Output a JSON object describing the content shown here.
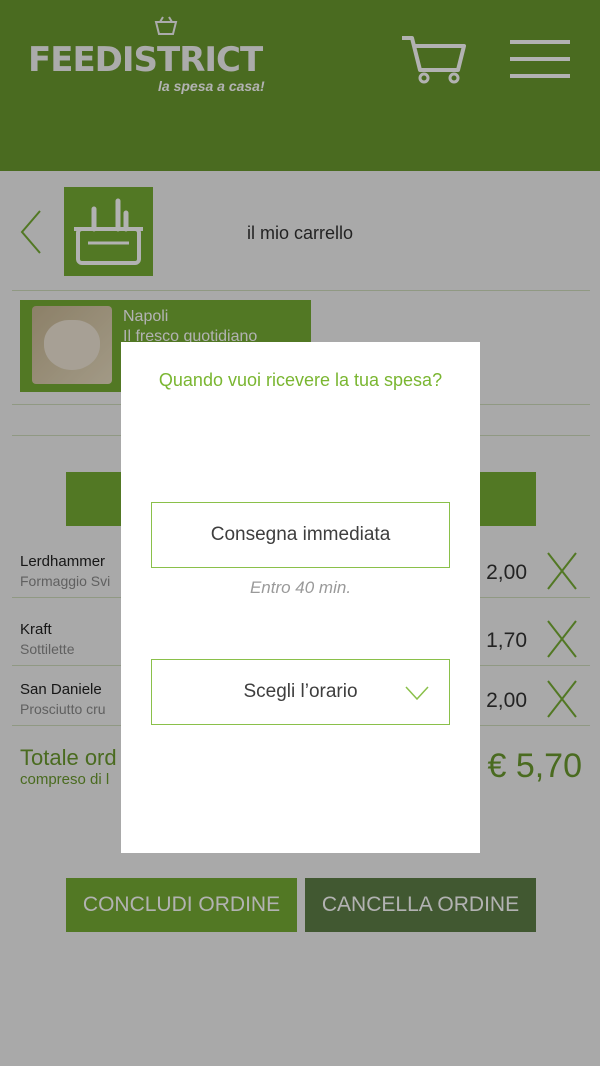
{
  "header": {
    "logo_text": "FEEDISTRICT",
    "tagline": "la spesa a casa!",
    "cart_icon": "cart-icon",
    "menu_icon": "hamburger-menu-icon"
  },
  "cart": {
    "title": "il mio carrello",
    "back_icon": "chevron-left-icon",
    "basket_icon": "basket-icon"
  },
  "store": {
    "city": "Napoli",
    "name": "Il fresco quotidiano"
  },
  "items": [
    {
      "name": "Lerdhammer",
      "desc": "Formaggio Svi",
      "price": "2,00"
    },
    {
      "name": "Kraft",
      "desc": "Sottilette",
      "price": "1,70"
    },
    {
      "name": "San Daniele",
      "desc": "Prosciutto cru",
      "price": "2,00"
    }
  ],
  "total": {
    "label": "Totale ord",
    "sub": "compreso di l",
    "value": "€ 5,70"
  },
  "buttons": {
    "conclude": "CONCLUDI ORDINE",
    "cancel": "CANCELLA ORDINE"
  },
  "modal": {
    "title": "Quando vuoi ricevere la tua spesa?",
    "immediate": "Consegna immediata",
    "note": "Entro 40 min.",
    "choose_time": "Scegli l’orario"
  },
  "colors": {
    "brand_green": "#76ad34",
    "header_green": "#6a9a2e",
    "dark_green": "#5e7f47"
  }
}
